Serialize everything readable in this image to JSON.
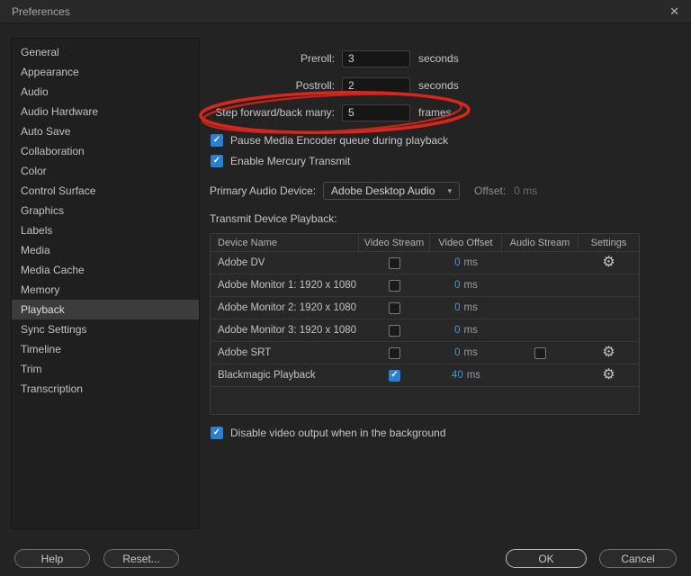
{
  "window": {
    "title": "Preferences"
  },
  "icons": {
    "close": "✕",
    "chevron_down": "▾",
    "gear": "⚙",
    "check": "✓"
  },
  "colors": {
    "checkbox_blue": "#2a7fd1",
    "value_blue": "#4596d9",
    "annotation_red": "#d8261a",
    "selected_bg": "#3c3c3c"
  },
  "sidebar": {
    "items": [
      {
        "label": "General",
        "selected": false
      },
      {
        "label": "Appearance",
        "selected": false
      },
      {
        "label": "Audio",
        "selected": false
      },
      {
        "label": "Audio Hardware",
        "selected": false
      },
      {
        "label": "Auto Save",
        "selected": false
      },
      {
        "label": "Collaboration",
        "selected": false
      },
      {
        "label": "Color",
        "selected": false
      },
      {
        "label": "Control Surface",
        "selected": false
      },
      {
        "label": "Graphics",
        "selected": false
      },
      {
        "label": "Labels",
        "selected": false
      },
      {
        "label": "Media",
        "selected": false
      },
      {
        "label": "Media Cache",
        "selected": false
      },
      {
        "label": "Memory",
        "selected": false
      },
      {
        "label": "Playback",
        "selected": true
      },
      {
        "label": "Sync Settings",
        "selected": false
      },
      {
        "label": "Timeline",
        "selected": false
      },
      {
        "label": "Trim",
        "selected": false
      },
      {
        "label": "Transcription",
        "selected": false
      }
    ]
  },
  "main": {
    "preroll": {
      "label": "Preroll:",
      "value": "3",
      "unit": "seconds"
    },
    "postroll": {
      "label": "Postroll:",
      "value": "2",
      "unit": "seconds"
    },
    "step": {
      "label": "Step forward/back many:",
      "value": "5",
      "unit": "frames"
    },
    "pause_encoder": {
      "label": "Pause Media Encoder queue during playback",
      "checked": true
    },
    "mercury": {
      "label": "Enable Mercury Transmit",
      "checked": true
    },
    "audio_device": {
      "label": "Primary Audio Device:",
      "value": "Adobe Desktop Audio",
      "offset_label": "Offset:",
      "offset_value": "0 ms"
    },
    "transmit_title": "Transmit Device Playback:",
    "table": {
      "columns": [
        "Device Name",
        "Video Stream",
        "Video Offset",
        "Audio Stream",
        "Settings"
      ],
      "rows": [
        {
          "name": "Adobe DV",
          "video_stream": false,
          "offset_value": "0",
          "offset_unit": "ms",
          "audio_stream": null,
          "has_audio": false,
          "has_settings": true
        },
        {
          "name": "Adobe Monitor 1: 1920 x 1080",
          "video_stream": false,
          "offset_value": "0",
          "offset_unit": "ms",
          "audio_stream": null,
          "has_audio": false,
          "has_settings": false
        },
        {
          "name": "Adobe Monitor 2: 1920 x 1080",
          "video_stream": false,
          "offset_value": "0",
          "offset_unit": "ms",
          "audio_stream": null,
          "has_audio": false,
          "has_settings": false
        },
        {
          "name": "Adobe Monitor 3: 1920 x 1080",
          "video_stream": false,
          "offset_value": "0",
          "offset_unit": "ms",
          "audio_stream": null,
          "has_audio": false,
          "has_settings": false
        },
        {
          "name": "Adobe SRT",
          "video_stream": false,
          "offset_value": "0",
          "offset_unit": "ms",
          "audio_stream": false,
          "has_audio": true,
          "has_settings": true
        },
        {
          "name": "Blackmagic Playback",
          "video_stream": true,
          "offset_value": "40",
          "offset_unit": "ms",
          "audio_stream": null,
          "has_audio": false,
          "has_settings": true
        }
      ]
    },
    "disable_bg": {
      "label": "Disable video output when in the background",
      "checked": true
    }
  },
  "footer": {
    "help": "Help",
    "reset": "Reset...",
    "ok": "OK",
    "cancel": "Cancel"
  }
}
